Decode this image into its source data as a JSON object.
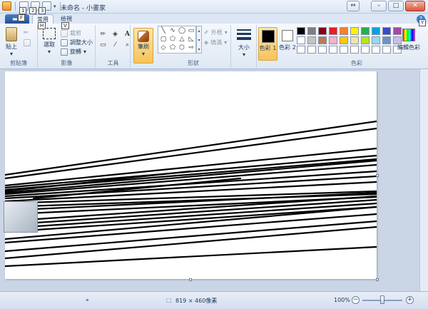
{
  "titlebar": {
    "title": "未命名 - 小畫家"
  },
  "keytips": {
    "app": "F",
    "save": "1",
    "undo": "2",
    "redo": "3",
    "home": "H",
    "view": "V",
    "help": "Y"
  },
  "tabs": {
    "file": "",
    "home": "常用",
    "view": "檢視"
  },
  "clipboard": {
    "paste": "貼上",
    "group": "剪貼簿"
  },
  "image": {
    "select": "選取",
    "crop": "裁剪",
    "resize": "調整大小",
    "rotate": "旋轉",
    "group": "影像"
  },
  "tools": {
    "group": "工具",
    "text": "A"
  },
  "brushes": {
    "label": "筆刷"
  },
  "shapes": {
    "outline": "外框",
    "fill": "填滿",
    "group": "形狀"
  },
  "size": {
    "label": "大小"
  },
  "colors": {
    "color1": "色彩 1",
    "color2": "色彩 2",
    "edit": "編輯色彩",
    "group": "色彩",
    "color1_value": "#000000",
    "color2_value": "#ffffff",
    "palette": [
      "#000000",
      "#7f7f7f",
      "#880015",
      "#ed1c24",
      "#ff7f27",
      "#fff200",
      "#22b14c",
      "#00a2e8",
      "#3f48cc",
      "#a349a4",
      "#ffffff",
      "#c3c3c3",
      "#b97a57",
      "#ffaec9",
      "#ffc90e",
      "#efe4b0",
      "#b5e61d",
      "#99d9ea",
      "#7092be",
      "#c8bfe7",
      "#ffffff",
      "#ffffff",
      "#ffffff",
      "#ffffff",
      "#ffffff",
      "#ffffff",
      "#ffffff",
      "#ffffff",
      "#ffffff",
      "#ffffff"
    ]
  },
  "status": {
    "dimensions": "819 × 460像素",
    "zoom": "100%"
  }
}
